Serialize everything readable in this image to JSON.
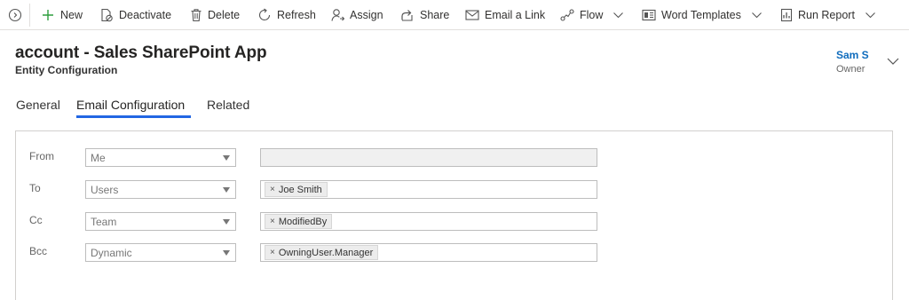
{
  "toolbar": {
    "new_label": "New",
    "deactivate_label": "Deactivate",
    "delete_label": "Delete",
    "refresh_label": "Refresh",
    "assign_label": "Assign",
    "share_label": "Share",
    "email_link_label": "Email a Link",
    "flow_label": "Flow",
    "word_templates_label": "Word Templates",
    "run_report_label": "Run Report"
  },
  "header": {
    "title": "account - Sales SharePoint App",
    "subtitle": "Entity Configuration",
    "owner_name": "Sam S",
    "owner_label": "Owner"
  },
  "tabs": [
    {
      "label": "General",
      "active": false
    },
    {
      "label": "Email Configuration",
      "active": true
    },
    {
      "label": "Related",
      "active": false
    }
  ],
  "email_config": {
    "rows": [
      {
        "label": "From",
        "type_value": "Me",
        "recipient": null
      },
      {
        "label": "To",
        "type_value": "Users",
        "recipient": "Joe Smith"
      },
      {
        "label": "Cc",
        "type_value": "Team",
        "recipient": "ModifiedBy"
      },
      {
        "label": "Bcc",
        "type_value": "Dynamic",
        "recipient": "OwningUser.Manager"
      }
    ],
    "chip_remove_glyph": "×"
  },
  "colors": {
    "accent": "#2266e3",
    "owner_link": "#0f6cbd",
    "new_plus": "#2e9e3e"
  }
}
